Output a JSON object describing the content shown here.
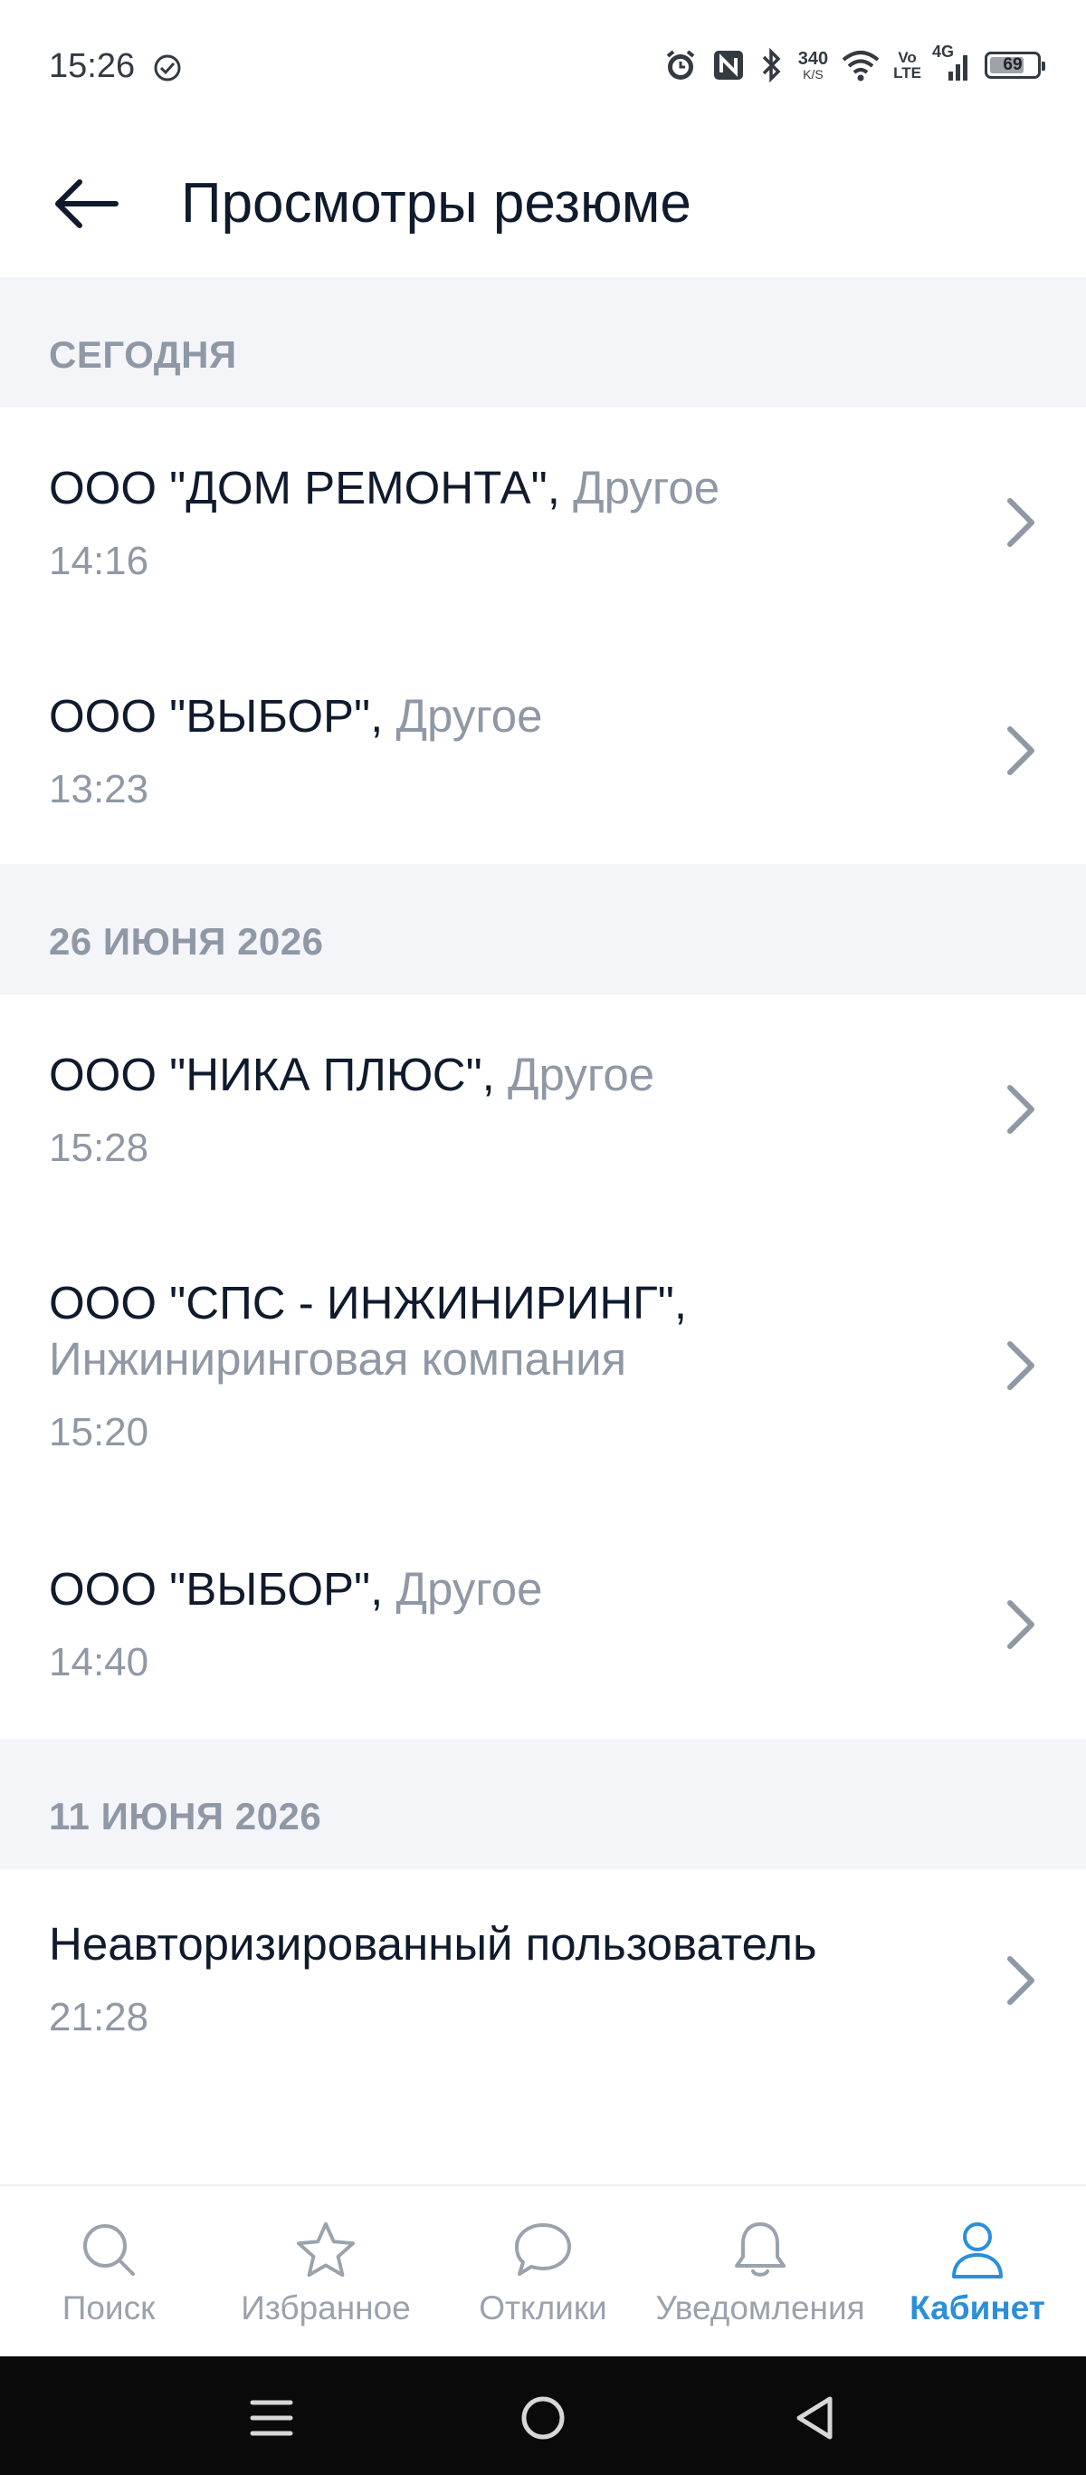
{
  "status_bar": {
    "time": "15:26",
    "net_speed_value": "340",
    "net_speed_unit": "K/S",
    "volte_top": "Vo",
    "volte_bottom": "LTE",
    "network": "4G",
    "battery_level": "69"
  },
  "header": {
    "title": "Просмотры резюме"
  },
  "sections": [
    {
      "label": "СЕГОДНЯ",
      "items": [
        {
          "company": "ООО \"ДОМ РЕМОНТА\",",
          "category": "Другое",
          "time": "14:16"
        },
        {
          "company": "ООО \"ВЫБОР\",",
          "category": "Другое",
          "time": "13:23"
        }
      ]
    },
    {
      "label": "26 ИЮНЯ 2026",
      "items": [
        {
          "company": "ООО \"НИКА ПЛЮС\",",
          "category": "Другое",
          "time": "15:28"
        },
        {
          "company": "ООО \"СПС - ИНЖИНИРИНГ\",",
          "category": "Инжиниринговая компания",
          "time": "15:20"
        },
        {
          "company": "ООО \"ВЫБОР\",",
          "category": "Другое",
          "time": "14:40"
        }
      ]
    },
    {
      "label": "11 ИЮНЯ 2026",
      "items": [
        {
          "company": "Неавторизированный пользователь",
          "time": "21:28"
        }
      ]
    }
  ],
  "bottom_nav": {
    "items": [
      {
        "label": "Поиск",
        "icon": "search-icon"
      },
      {
        "label": "Избранное",
        "icon": "star-icon"
      },
      {
        "label": "Отклики",
        "icon": "chat-bubble-icon"
      },
      {
        "label": "Уведомления",
        "icon": "bell-icon"
      },
      {
        "label": "Кабинет",
        "icon": "user-icon"
      }
    ],
    "active_index": 4
  },
  "colors": {
    "accent": "#2b8fd9",
    "text_primary": "#0f1b2d",
    "text_muted": "#8f98a5",
    "section_bg": "#f3f5f8"
  }
}
